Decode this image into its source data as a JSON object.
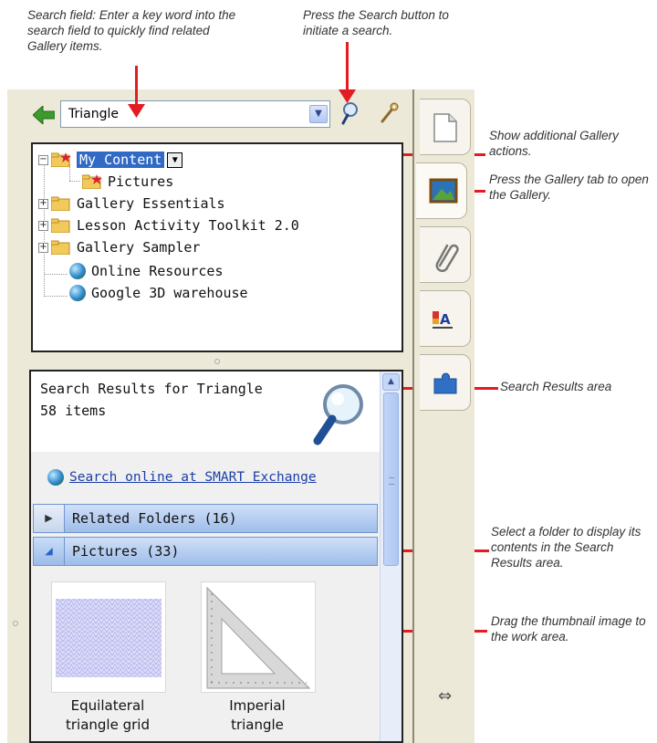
{
  "annotations": {
    "search_field": "Search field: Enter a key word into the search field to quickly find related Gallery items.",
    "search_button": "Press the Search button to initiate a search.",
    "gallery_actions": "Show additional Gallery actions.",
    "gallery_tab": "Press the Gallery tab to open the Gallery.",
    "search_results": "Search Results area",
    "select_folder": "Select a folder to display its contents in the Search Results area.",
    "drag_thumbnail": "Drag the thumbnail image to the work area."
  },
  "search": {
    "value": "Triangle"
  },
  "tree": {
    "my_content": "My Content",
    "pictures": "Pictures",
    "gallery_essentials": "Gallery Essentials",
    "lesson_toolkit": "Lesson Activity Toolkit 2.0",
    "gallery_sampler": "Gallery Sampler",
    "online_resources": "Online Resources",
    "google_3d": "Google 3D warehouse"
  },
  "results": {
    "title": "Search Results for Triangle",
    "count": "58 items",
    "search_online": "Search online at SMART Exchange",
    "related_folders": "Related Folders (16)",
    "pictures_section": "Pictures (33)",
    "items": [
      {
        "caption_1": "Equilateral",
        "caption_2": "triangle grid"
      },
      {
        "caption_1": "Imperial",
        "caption_2": "triangle"
      }
    ]
  },
  "colors": {
    "arrow": "#e31b23",
    "selection": "#316ac5",
    "link": "#1b3ea8"
  }
}
